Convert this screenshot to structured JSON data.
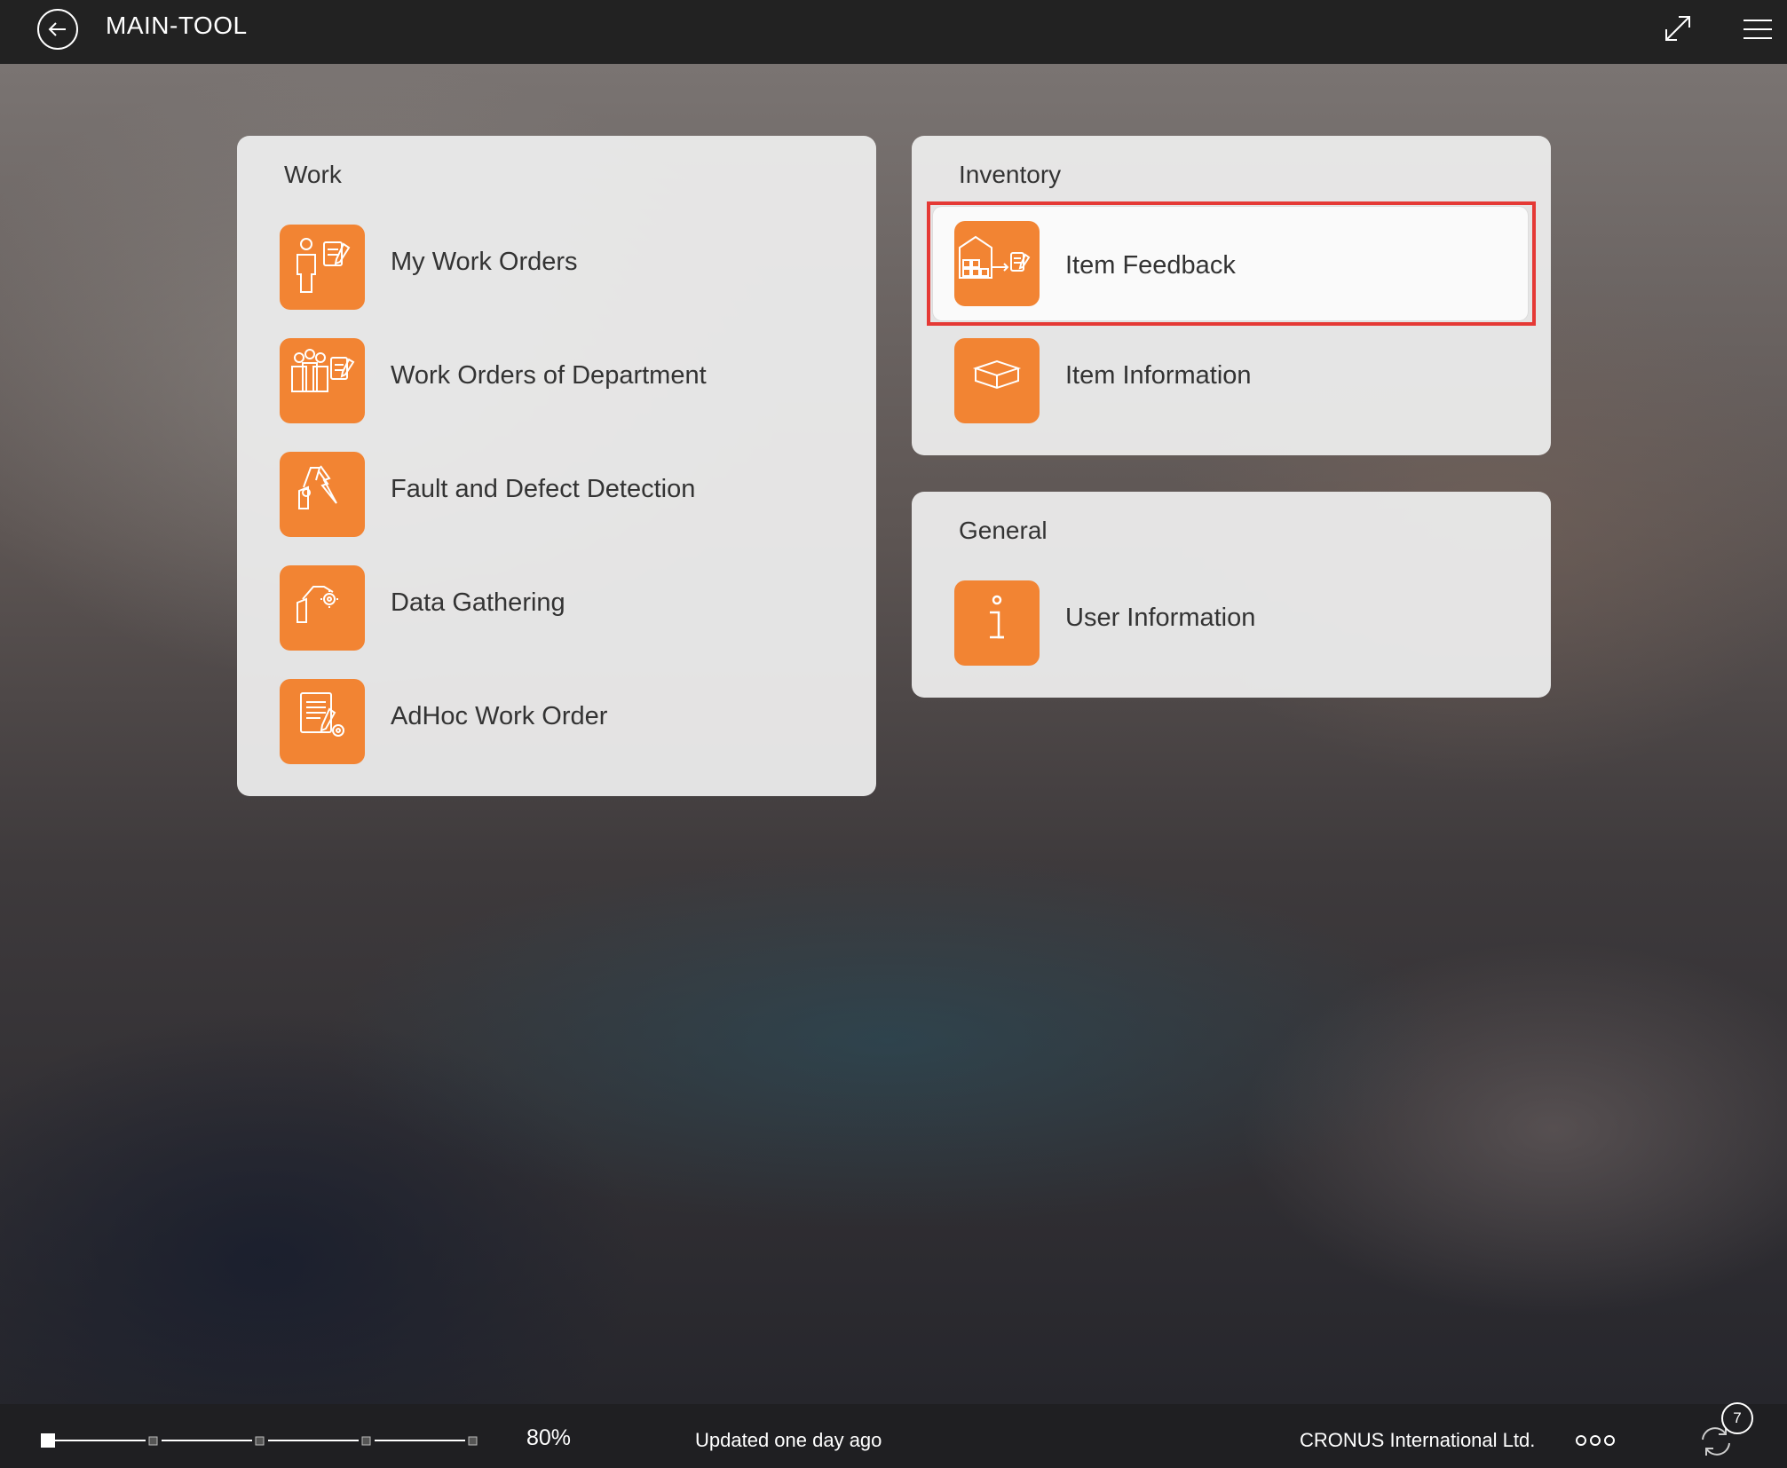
{
  "header": {
    "title": "MAIN-TOOL",
    "back_icon": "arrow-left-circle-icon",
    "expand_icon": "expand-diagonal-icon",
    "menu_icon": "hamburger-menu-icon"
  },
  "panels": {
    "work": {
      "title": "Work",
      "items": [
        {
          "label": "My Work Orders",
          "icon": "worker-document-icon"
        },
        {
          "label": "Work Orders of Department",
          "icon": "team-document-icon"
        },
        {
          "label": "Fault and Defect Detection",
          "icon": "robot-arm-fault-icon"
        },
        {
          "label": "Data Gathering",
          "icon": "robot-arm-gear-icon"
        },
        {
          "label": "AdHoc Work Order",
          "icon": "document-pen-icon"
        }
      ]
    },
    "inventory": {
      "title": "Inventory",
      "items": [
        {
          "label": "Item Feedback",
          "icon": "warehouse-feedback-icon",
          "selected": true
        },
        {
          "label": "Item Information",
          "icon": "box-icon"
        }
      ]
    },
    "general": {
      "title": "General",
      "items": [
        {
          "label": "User Information",
          "icon": "info-icon"
        }
      ]
    }
  },
  "footer": {
    "zoom": "80%",
    "zoom_level_fraction": 0.0,
    "updated": "Updated one day ago",
    "company": "CRONUS International Ltd.",
    "more_icon": "ellipsis-icon",
    "sync_icon": "sync-icon",
    "sync_count": "7"
  },
  "colors": {
    "accent": "#f28433",
    "topbar": "#222222",
    "panel": "#ececec",
    "highlight": "#e53935"
  }
}
